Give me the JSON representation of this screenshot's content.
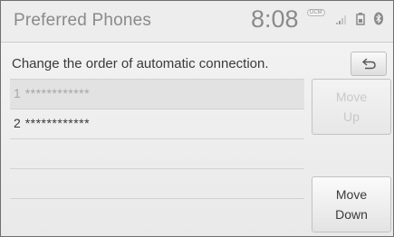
{
  "header": {
    "title": "Preferred Phones",
    "clock": "8:08",
    "status": {
      "dcm_label": "DCM",
      "icons": [
        "signal-bars-icon",
        "phone-battery-icon",
        "bluetooth-icon"
      ]
    }
  },
  "main": {
    "instruction": "Change the order of automatic connection.",
    "back_icon": "return-arrow-icon",
    "phones": [
      {
        "number": "1",
        "name": "************",
        "selected": true
      },
      {
        "number": "2",
        "name": "************",
        "selected": false
      }
    ]
  },
  "buttons": {
    "move_up": {
      "line1": "Move",
      "line2": "Up",
      "enabled": false
    },
    "move_down": {
      "line1": "Move",
      "line2": "Down",
      "enabled": true
    }
  }
}
